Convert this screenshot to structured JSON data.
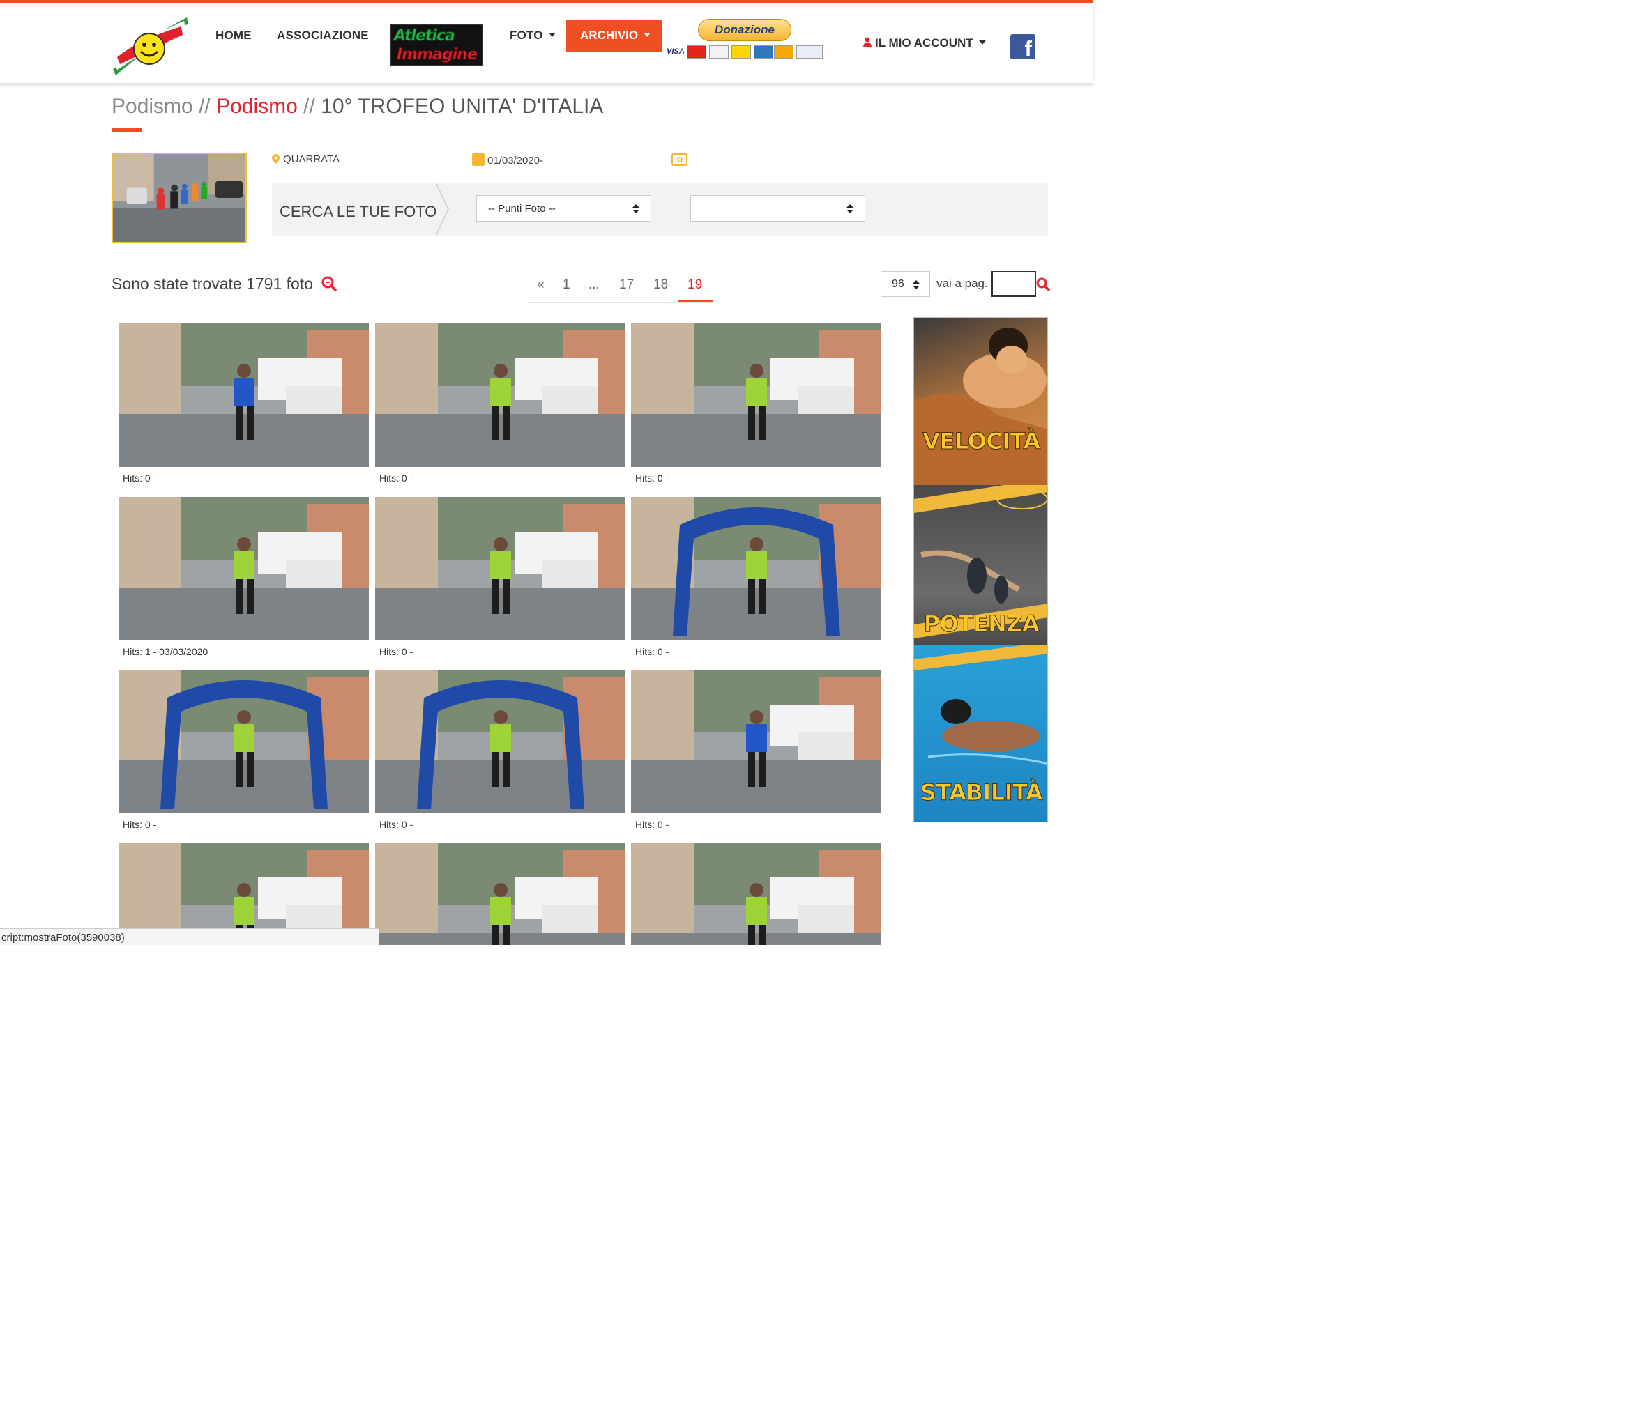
{
  "nav": {
    "home": "HOME",
    "associazione": "ASSOCIAZIONE",
    "partner_logo_line1": "Atletica",
    "partner_logo_line2": "Immagine",
    "foto": "FOTO",
    "archivio": "ARCHIVIO",
    "donate": "Donazione",
    "account": "IL MIO ACCOUNT",
    "facebook": "f",
    "accent_color": "#f04e23"
  },
  "breadcrumb": {
    "level1": "Podismo",
    "sep": "//",
    "level2": "Podismo",
    "title": "10° TROFEO UNITA' D'ITALIA"
  },
  "event": {
    "location": "QUARRATA",
    "date": "01/03/2020-"
  },
  "search": {
    "label": "CERCA LE TUE FOTO",
    "select1": "-- Punti Foto --",
    "select2": ""
  },
  "results": {
    "found_text": "Sono state trovate 1791 foto",
    "pages": [
      "«",
      "1",
      "...",
      "17",
      "18",
      "19"
    ],
    "active_page": "19",
    "per_page": "96",
    "goto_label": "vai a pag."
  },
  "photos": [
    {
      "hits": "Hits: 0 -"
    },
    {
      "hits": "Hits: 0 -"
    },
    {
      "hits": "Hits: 0 -"
    },
    {
      "hits": "Hits: 1 - 03/03/2020"
    },
    {
      "hits": "Hits: 0 -"
    },
    {
      "hits": "Hits: 0 -"
    },
    {
      "hits": "Hits: 0 -"
    },
    {
      "hits": "Hits: 0 -"
    },
    {
      "hits": "Hits: 0 -"
    },
    {
      "hits": ""
    },
    {
      "hits": ""
    },
    {
      "hits": ""
    }
  ],
  "ad": {
    "word1": "VELOCITÀ",
    "word2": "POTENZA",
    "word3": "STABILITÀ"
  },
  "status_bar": "cript:mostraFoto(3590038)"
}
